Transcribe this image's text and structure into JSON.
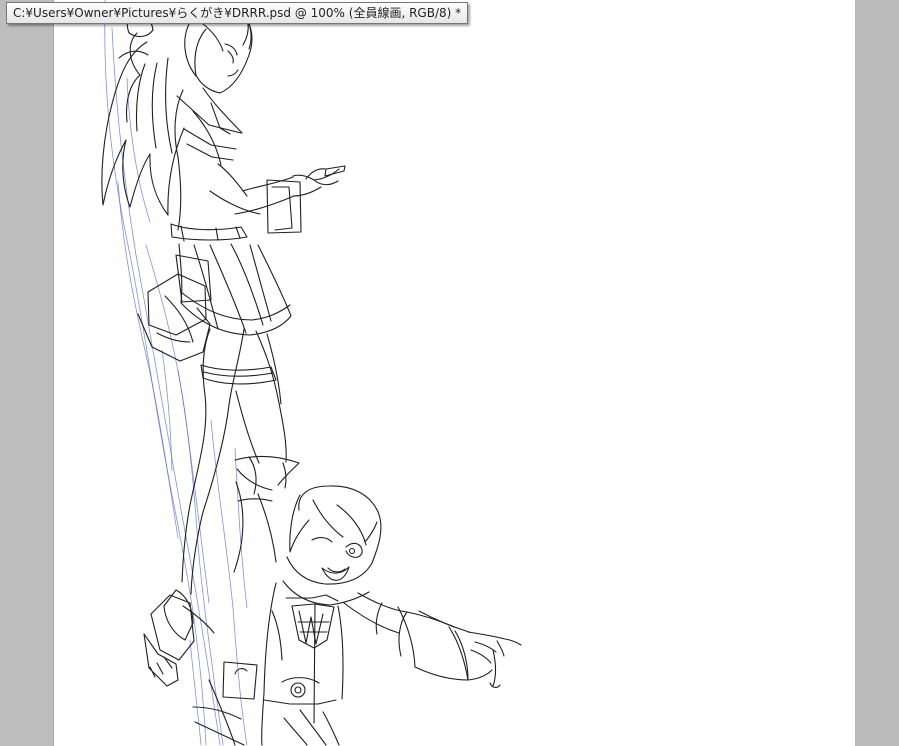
{
  "document": {
    "title": "C:¥Users¥Owner¥Pictures¥らくがき¥DRRR.psd @ 100% (全員線画, RGB/8) *"
  },
  "colors": {
    "workspace": "#bdbdbd",
    "canvas": "#ffffff",
    "line_art": "#202020",
    "guide_lines": "#5668c8"
  }
}
